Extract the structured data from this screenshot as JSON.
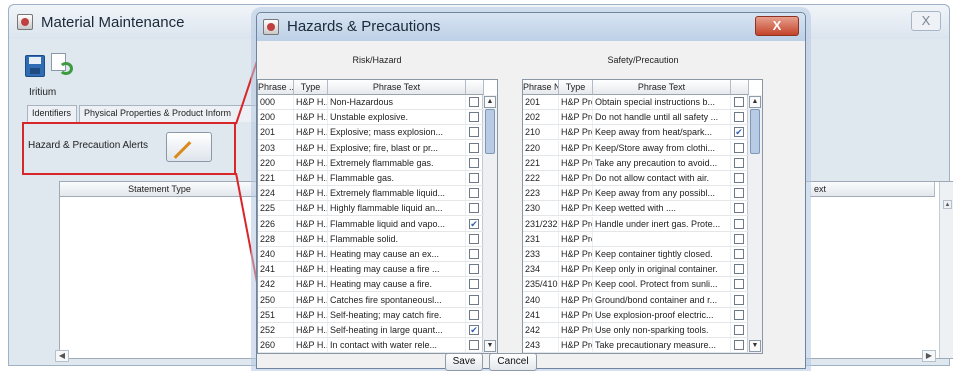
{
  "bg_window": {
    "title": "Material Maintenance",
    "close_glyph": "X",
    "item_label": "Iritium",
    "tabs": [
      "Identifiers",
      "Physical Properties & Product Inform"
    ],
    "alerts_label": "Hazard & Precaution Alerts",
    "table_headers": [
      "Statement Type",
      "ext"
    ]
  },
  "dialog": {
    "title": "Hazards & Precautions",
    "close_glyph": "X",
    "left_panel": {
      "title": "Risk/Hazard",
      "columns": [
        "Phrase ...",
        "Type",
        "Phrase Text"
      ],
      "rows": [
        {
          "phrase": "000",
          "type": "H&P H...",
          "text": "Non-Hazardous",
          "checked": false
        },
        {
          "phrase": "200",
          "type": "H&P H...",
          "text": "Unstable explosive.",
          "checked": false
        },
        {
          "phrase": "201",
          "type": "H&P H...",
          "text": "Explosive; mass explosion...",
          "checked": false
        },
        {
          "phrase": "203",
          "type": "H&P H...",
          "text": "Explosive; fire, blast or pr...",
          "checked": false
        },
        {
          "phrase": "220",
          "type": "H&P H...",
          "text": "Extremely flammable gas.",
          "checked": false
        },
        {
          "phrase": "221",
          "type": "H&P H...",
          "text": "Flammable gas.",
          "checked": false
        },
        {
          "phrase": "224",
          "type": "H&P H...",
          "text": "Extremely flammable liquid...",
          "checked": false
        },
        {
          "phrase": "225",
          "type": "H&P H...",
          "text": "Highly flammable liquid an...",
          "checked": false
        },
        {
          "phrase": "226",
          "type": "H&P H...",
          "text": "Flammable liquid and vapo...",
          "checked": true
        },
        {
          "phrase": "228",
          "type": "H&P H...",
          "text": "Flammable solid.",
          "checked": false
        },
        {
          "phrase": "240",
          "type": "H&P H...",
          "text": "Heating may cause an ex...",
          "checked": false
        },
        {
          "phrase": "241",
          "type": "H&P H...",
          "text": "Heating may cause a fire ...",
          "checked": false
        },
        {
          "phrase": "242",
          "type": "H&P H...",
          "text": "Heating may cause a fire.",
          "checked": false
        },
        {
          "phrase": "250",
          "type": "H&P H...",
          "text": "Catches fire spontaneousl...",
          "checked": false
        },
        {
          "phrase": "251",
          "type": "H&P H...",
          "text": "Self-heating; may catch fire.",
          "checked": false
        },
        {
          "phrase": "252",
          "type": "H&P H...",
          "text": "Self-heating in large quant...",
          "checked": true
        },
        {
          "phrase": "260",
          "type": "H&P H...",
          "text": "In contact with water rele...",
          "checked": false
        }
      ]
    },
    "right_panel": {
      "title": "Safety/Precaution",
      "columns": [
        "Phrase N...",
        "Type",
        "Phrase Text"
      ],
      "rows": [
        {
          "phrase": "201",
          "type": "H&P Pre...",
          "text": "Obtain special instructions b...",
          "checked": false
        },
        {
          "phrase": "202",
          "type": "H&P Pre...",
          "text": "Do not handle until all safety ...",
          "checked": false
        },
        {
          "phrase": "210",
          "type": "H&P Pre...",
          "text": "Keep away from heat/spark...",
          "checked": true
        },
        {
          "phrase": "220",
          "type": "H&P Pre...",
          "text": "Keep/Store away from clothi...",
          "checked": false
        },
        {
          "phrase": "221",
          "type": "H&P Pre...",
          "text": "Take any precaution to avoid...",
          "checked": false
        },
        {
          "phrase": "222",
          "type": "H&P Pre...",
          "text": "Do not allow contact with air.",
          "checked": false
        },
        {
          "phrase": "223",
          "type": "H&P Pre...",
          "text": "Keep away from any possibl...",
          "checked": false
        },
        {
          "phrase": "230",
          "type": "H&P Pre...",
          "text": "Keep wetted with ....",
          "checked": false
        },
        {
          "phrase": "231/232",
          "type": "H&P Pre...",
          "text": "Handle under inert gas. Prote...",
          "checked": false
        },
        {
          "phrase": "231",
          "type": "H&P Pre...",
          "text": "",
          "checked": false
        },
        {
          "phrase": "233",
          "type": "H&P Pre...",
          "text": "Keep container tightly closed.",
          "checked": false
        },
        {
          "phrase": "234",
          "type": "H&P Pre...",
          "text": "Keep only in original container.",
          "checked": false
        },
        {
          "phrase": "235/410",
          "type": "H&P Pre...",
          "text": "Keep cool. Protect from sunli...",
          "checked": false
        },
        {
          "phrase": "240",
          "type": "H&P Pre...",
          "text": "Ground/bond container and r...",
          "checked": false
        },
        {
          "phrase": "241",
          "type": "H&P Pre...",
          "text": "Use explosion-proof electric...",
          "checked": false
        },
        {
          "phrase": "242",
          "type": "H&P Pre...",
          "text": "Use only non-sparking tools.",
          "checked": false
        },
        {
          "phrase": "243",
          "type": "H&P Pre...",
          "text": "Take precautionary measure...",
          "checked": false
        }
      ]
    },
    "buttons": {
      "save": "Save",
      "cancel": "Cancel"
    }
  },
  "colors": {
    "highlight": "#d8262b",
    "checkmark": "#2f5fb8",
    "dialog_close": "#c4432a"
  }
}
